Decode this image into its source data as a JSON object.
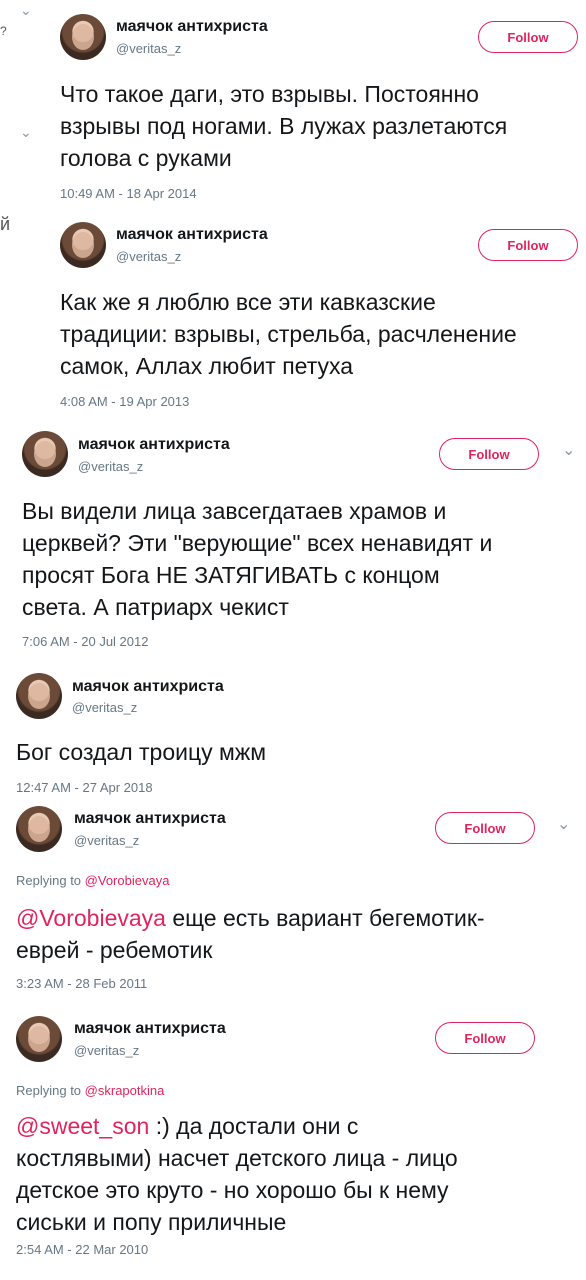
{
  "edge_glyphs": {
    "q": "?",
    "y": "й"
  },
  "tweets": [
    {
      "name": "маячок антихриста",
      "handle": "@veritas_z",
      "follow": "Follow",
      "lines": [
        "Что такое даги, это взрывы. Постоянно",
        "взрывы под ногами. В лужах разлетаются",
        "голова с руками"
      ],
      "time": "10:49 AM - 18 Apr 2014"
    },
    {
      "name": "маячок антихриста",
      "handle": "@veritas_z",
      "follow": "Follow",
      "lines": [
        "Как же я люблю все эти кавказские",
        "традиции: взрывы, стрельба, расчленение",
        "самок, Аллах любит петуха"
      ],
      "time": "4:08 AM - 19 Apr 2013"
    },
    {
      "name": "маячок антихриста",
      "handle": "@veritas_z",
      "follow": "Follow",
      "lines": [
        "Вы видели лица завсегдатаев храмов и",
        "церквей? Эти \"верующие\" всех ненавидят и",
        "просят Бога НЕ ЗАТЯГИВАТЬ с концом",
        "света. А патриарх чекист"
      ],
      "time": "7:06 AM - 20 Jul 2012"
    },
    {
      "name": "маячок антихриста",
      "handle": "@veritas_z",
      "lines": [
        "Бог создал троицу мжм"
      ],
      "time": "12:47 AM - 27 Apr 2018"
    },
    {
      "name": "маячок антихриста",
      "handle": "@veritas_z",
      "follow": "Follow",
      "replying_prefix": "Replying to",
      "replying_to": "@Vorobievaya",
      "mention": "@Vorobievaya",
      "lines": [
        " еще есть вариант бегемотик-",
        "еврей - ребемотик"
      ],
      "time": "3:23 AM - 28 Feb 2011"
    },
    {
      "name": "маячок антихриста",
      "handle": "@veritas_z",
      "follow": "Follow",
      "replying_prefix": "Replying to",
      "replying_to": "@skrapotkina",
      "mention": "@sweet_son",
      "lines": [
        " :) да достали они с",
        "костлявыми) насчет детского лица - лицо",
        "детское это круто - но хорошо бы к нему",
        "сиськи и попу приличные"
      ],
      "time": "2:54 AM - 22 Mar 2010"
    }
  ]
}
